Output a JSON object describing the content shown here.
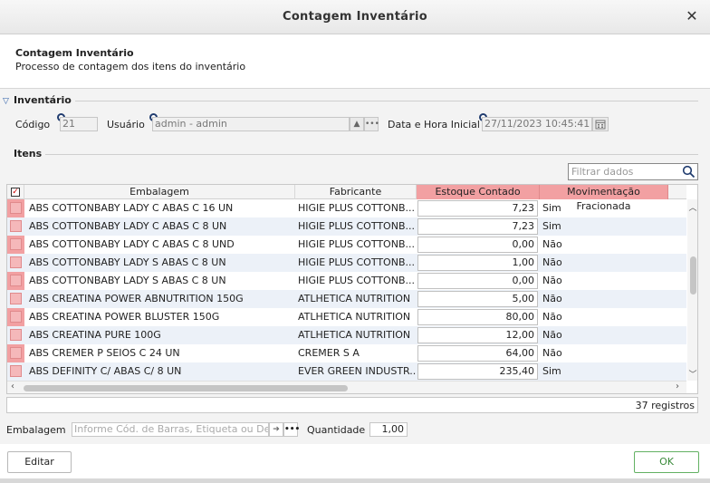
{
  "window": {
    "title": "Contagem Inventário",
    "close_glyph": "✕"
  },
  "header": {
    "title": "Contagem Inventário",
    "subtitle": "Processo de contagem dos itens do inventário"
  },
  "inventario": {
    "section_label": "Inventário",
    "codigo_label": "Código",
    "codigo_value": "21",
    "usuario_label": "Usuário",
    "usuario_value": "admin - admin",
    "data_label": "Data e Hora Inicial",
    "data_value": "27/11/2023 10:45:41"
  },
  "itens": {
    "section_label": "Itens",
    "filter_placeholder": "Filtrar dados",
    "columns": [
      "Embalagem",
      "Fabricante",
      "Estoque Contado",
      "Movimentação Fracionada"
    ],
    "rows": [
      {
        "embalagem": "ABS COTTONBABY LADY C ABAS C 16 UN",
        "fabricante": "HIGIE PLUS COTTONB...",
        "estoque": "7,23",
        "mov": "Sim"
      },
      {
        "embalagem": "ABS COTTONBABY LADY C ABAS C 8 UN",
        "fabricante": "HIGIE PLUS COTTONB...",
        "estoque": "7,23",
        "mov": "Sim"
      },
      {
        "embalagem": "ABS COTTONBABY LADY C ABAS C  8 UND",
        "fabricante": "HIGIE PLUS COTTONB...",
        "estoque": "0,00",
        "mov": "Não"
      },
      {
        "embalagem": "ABS COTTONBABY LADY S ABAS C  8 UN",
        "fabricante": "HIGIE PLUS COTTONB...",
        "estoque": "1,00",
        "mov": "Não"
      },
      {
        "embalagem": "ABS COTTONBABY LADY S ABAS C  8 UN",
        "fabricante": "HIGIE PLUS COTTONB...",
        "estoque": "0,00",
        "mov": "Não"
      },
      {
        "embalagem": "ABS CREATINA POWER ABNUTRITION 150G",
        "fabricante": "ATLHETICA NUTRITION",
        "estoque": "5,00",
        "mov": "Não"
      },
      {
        "embalagem": "ABS CREATINA POWER BLUSTER 150G",
        "fabricante": "ATLHETICA NUTRITION",
        "estoque": "80,00",
        "mov": "Não"
      },
      {
        "embalagem": "ABS CREATINA PURE 100G",
        "fabricante": "ATLHETICA NUTRITION",
        "estoque": "12,00",
        "mov": "Não"
      },
      {
        "embalagem": "ABS CREMER P SEIOS C 24 UN",
        "fabricante": "CREMER S A",
        "estoque": "64,00",
        "mov": "Não"
      },
      {
        "embalagem": "ABS DEFINITY C/ ABAS C/ 8 UN",
        "fabricante": "EVER GREEN INDUSTR...",
        "estoque": "235,40",
        "mov": "Sim"
      }
    ],
    "record_count": "37 registros"
  },
  "bottom": {
    "embalagem_label": "Embalagem",
    "embalagem_placeholder": "Informe Cód. de Barras, Etiqueta ou Descrição",
    "quantidade_label": "Quantidade",
    "quantidade_value": "1,00"
  },
  "buttons": {
    "editar": "Editar",
    "ok": "OK"
  },
  "colors": {
    "highlight": "#f2a0a2",
    "accent": "#1f3b6e",
    "ok": "#3a8a3a"
  }
}
